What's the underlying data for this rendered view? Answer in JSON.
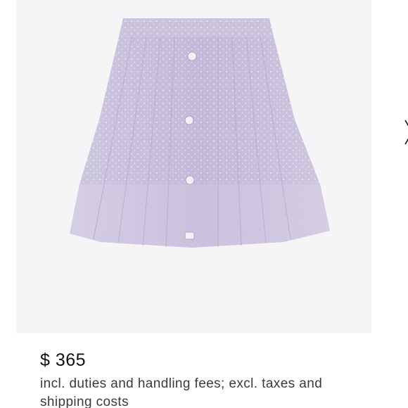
{
  "product": {
    "image_description_icon": "skirt-image",
    "price": "$ 365",
    "tax_note": "incl. duties and handling fees; excl. taxes and shipping costs"
  },
  "gallery": {
    "next_icon": "chevron-right-icon"
  },
  "colors": {
    "background": "#ffffff",
    "image_background": "#f5f4f6",
    "skirt": "#c9c1dd",
    "price_text": "#111111",
    "note_text": "#3a3a3a"
  }
}
